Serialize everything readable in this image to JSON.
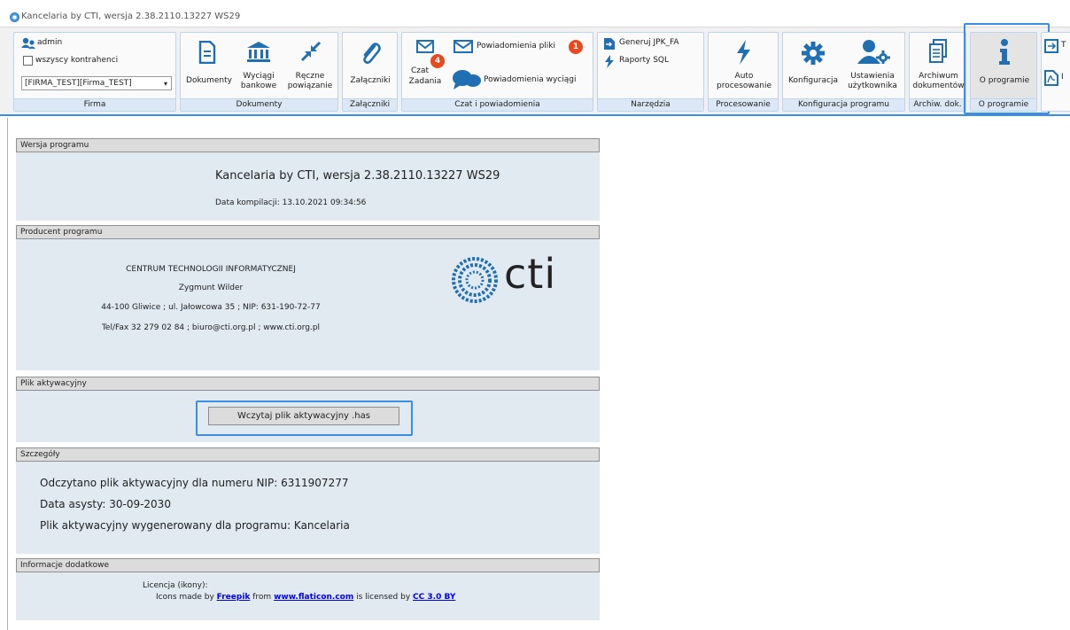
{
  "window": {
    "title": "Kancelaria by CTI, wersja  2.38.2110.13227 WS29"
  },
  "ribbon": {
    "firma": {
      "user": "admin",
      "all_contractors": "wszyscy kontrahenci",
      "company_select": "[FIRMA_TEST][Firma_TEST]",
      "group_label": "Firma"
    },
    "dokumenty": {
      "documents": "Dokumenty",
      "bank_statements_1": "Wyciągi",
      "bank_statements_2": "bankowe",
      "manual_links_1": "Ręczne",
      "manual_links_2": "powiązanie",
      "group_label": "Dokumenty"
    },
    "zalaczniki": {
      "attachments": "Załączniki",
      "group_label": "Załączniki"
    },
    "czat": {
      "chat_1": "Czat",
      "chat_2": "Zadania",
      "chat_badge": "4",
      "notif_files": "Powiadomienia pliki",
      "notif_files_badge": "1",
      "notif_statements": "Powiadomienia wyciągi",
      "group_label": "Czat i powiadomienia"
    },
    "narzedzia": {
      "jpk": "Generuj JPK_FA",
      "sql": "Raporty SQL",
      "group_label": "Narzędzia"
    },
    "procesowanie": {
      "auto_1": "Auto",
      "auto_2": "procesowanie",
      "group_label": "Procesowanie"
    },
    "konfiguracja": {
      "config": "Konfiguracja",
      "user_settings_1": "Ustawienia",
      "user_settings_2": "użytkownika",
      "group_label": "Konfiguracja programu"
    },
    "archiwum": {
      "archive_1": "Archiwum",
      "archive_2": "dokumentów",
      "group_label": "Archiw. dok."
    },
    "oprogramie": {
      "about": "O programie",
      "group_label": "O programie"
    },
    "extra": {
      "t": "T",
      "i": "I"
    }
  },
  "content": {
    "version": {
      "header": "Wersja programu",
      "name": "Kancelaria by CTI, wersja  2.38.2110.13227 WS29",
      "build_date": "Data kompilacji:  13.10.2021 09:34:56"
    },
    "producer": {
      "header": "Producent programu",
      "company": "CENTRUM TECHNOLOGII INFORMATYCZNEJ",
      "owner": "Zygmunt Wilder",
      "address": "44-100 Gliwice ; ul. Jałowcowa 35 ; NIP: 631-190-72-77",
      "contact": "Tel/Fax 32 279 02 84 ; biuro@cti.org.pl ; www.cti.org.pl",
      "logo_text": "cti"
    },
    "activation": {
      "header": "Plik aktywacyjny",
      "load_button": "Wczytaj plik aktywacyjny .has"
    },
    "details": {
      "header": "Szczegóły",
      "line1": "Odczytano plik aktywacyjny dla numeru NIP: 6311907277",
      "line2": "Data asysty: 30-09-2030",
      "line3": "Plik aktywacyjny wygenerowany dla programu: Kancelaria"
    },
    "additional": {
      "header": "Informacje dodatkowe",
      "license_label": "Licencja (ikony):",
      "icons_made_by": "Icons made by ",
      "freepik": "Freepik",
      "from": " from ",
      "flaticon": "www.flaticon.com",
      "licensed_by": " is licensed by ",
      "cc": "CC 3.0 BY"
    }
  },
  "colors": {
    "accent": "#3a8ee6",
    "icon_blue": "#1f6fb2",
    "badge": "#e8491d"
  }
}
